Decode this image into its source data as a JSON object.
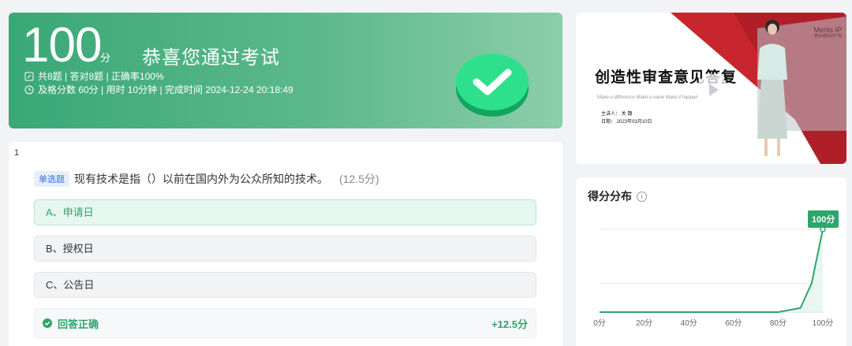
{
  "summary": {
    "score": "100",
    "score_unit": "分",
    "congrats": "恭喜您通过考试",
    "stats_line1": "共8题 | 答对8题 | 正确率100%",
    "stats_line2": "及格分数 60分 | 用时 10分钟 | 完成时间 2024-12-24 20:18:49",
    "accent_color": "#3aa876"
  },
  "question": {
    "number": "1",
    "type_label": "单选题",
    "text": "现有技术是指（）以前在国内外为公众所知的技术。",
    "score": "(12.5分)",
    "options": [
      {
        "label": "A、申请日",
        "state": "correct"
      },
      {
        "label": "B、授权日",
        "state": "normal"
      },
      {
        "label": "C、公告日",
        "state": "normal"
      }
    ],
    "result_label": "回答正确",
    "result_points": "+12.5分"
  },
  "video": {
    "title": "创造性审查意见答复",
    "subtitle": "Make a difference Make a value Make it happen",
    "speaker": "主讲人：  关 魏",
    "date": "日期：  2023年03月10日",
    "logo_name": "Merits IP",
    "logo_sub": "德合诚知识产权"
  },
  "distribution": {
    "title": "得分分布",
    "tooltip": "100分"
  },
  "chart_data": {
    "type": "area",
    "x": [
      0,
      20,
      40,
      60,
      80,
      90,
      95,
      100
    ],
    "values": [
      0,
      0,
      0,
      0,
      0,
      0.05,
      0.35,
      1
    ],
    "tick_labels": [
      "0分",
      "20分",
      "40分",
      "60分",
      "80分",
      "100分"
    ],
    "xlim": [
      0,
      100
    ],
    "color": "#2ea56c"
  }
}
